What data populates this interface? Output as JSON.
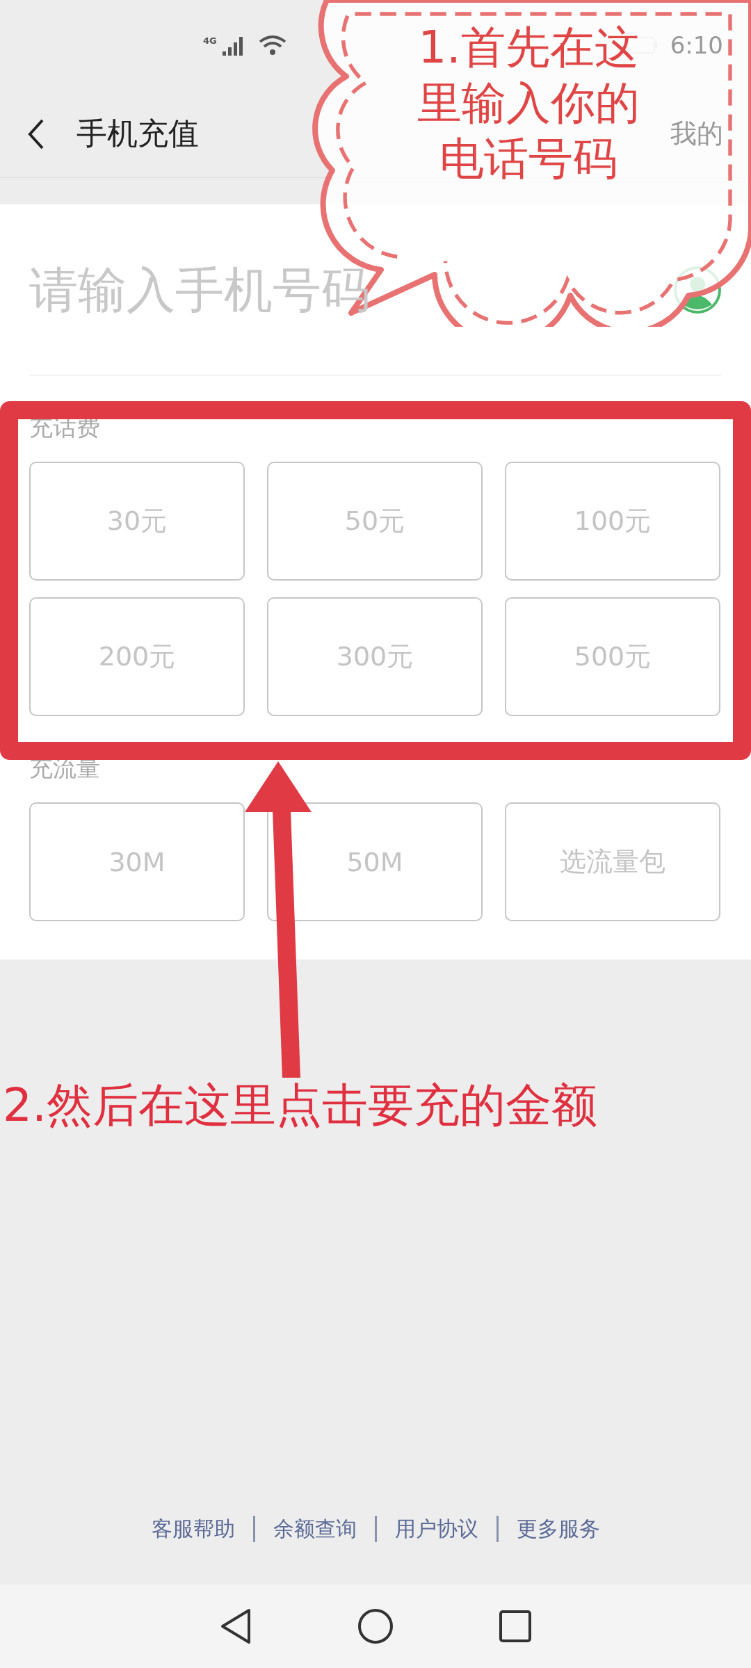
{
  "status_bar": {
    "network": "4G",
    "time": "6:10"
  },
  "header": {
    "title": "手机充值",
    "right_action": "我的"
  },
  "phone_input": {
    "placeholder": "请输入手机号码"
  },
  "sections": [
    {
      "label": "充话费",
      "options": [
        "30元",
        "50元",
        "100元",
        "200元",
        "300元",
        "500元"
      ]
    },
    {
      "label": "充流量",
      "options": [
        "30M",
        "50M",
        "选流量包"
      ]
    }
  ],
  "footer_links": [
    "客服帮助",
    "余额查询",
    "用户协议",
    "更多服务"
  ],
  "annotations": [
    {
      "kind": "callout",
      "lines": [
        "1.首先在这",
        "里输入你的",
        "电话号码"
      ]
    },
    {
      "kind": "highlight"
    },
    {
      "kind": "arrow"
    },
    {
      "kind": "caption",
      "text": "2.然后在这里点击要充的金额"
    }
  ]
}
